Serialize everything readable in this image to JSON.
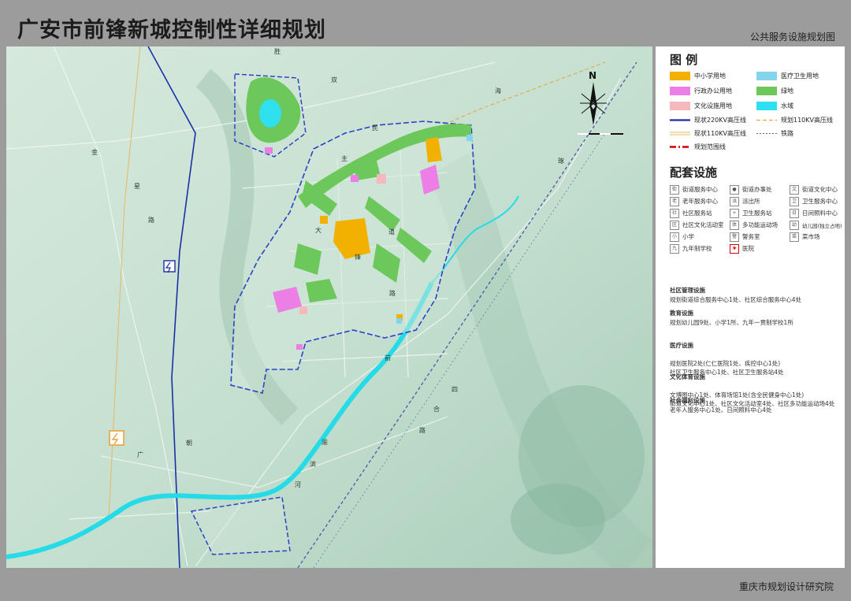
{
  "header": {
    "title": "广安市前锋新城控制性详细规划",
    "subtitle": "公共服务设施规划图"
  },
  "footer": {
    "org": "重庆市规划设计研究院"
  },
  "compass": {
    "label": "N"
  },
  "legend": {
    "title": "图 例",
    "items": [
      {
        "label": "中小学用地",
        "color": "#f2b000",
        "kind": "fill"
      },
      {
        "label": "医疗卫生用地",
        "color": "#84d4ee",
        "kind": "fill"
      },
      {
        "label": "行政办公用地",
        "color": "#ec7ee6",
        "kind": "fill"
      },
      {
        "label": "绿地",
        "color": "#6cc85a",
        "kind": "fill"
      },
      {
        "label": "文化设施用地",
        "color": "#f5b8bd",
        "kind": "fill"
      },
      {
        "label": "水域",
        "color": "#2fe0ee",
        "kind": "fill"
      },
      {
        "label": "现状220KV高压线",
        "color": "#1a2fa8",
        "kind": "line-solid-thick"
      },
      {
        "label": "规划110KV高压线",
        "color": "#e8a43a",
        "kind": "line-dash"
      },
      {
        "label": "现状110KV高压线",
        "color": "#e8b860",
        "kind": "line-double"
      },
      {
        "label": "铁路",
        "color": "#5a66b0",
        "kind": "line-dash-thin"
      },
      {
        "label": "规划范围线",
        "color": "#d00000",
        "kind": "line-dashdot"
      }
    ]
  },
  "facilities": {
    "title": "配套设施",
    "items": [
      {
        "icon": "街",
        "label": "街道服务中心"
      },
      {
        "icon": "●",
        "label": "街道办事处"
      },
      {
        "icon": "文",
        "label": "街道文化中心"
      },
      {
        "icon": "老",
        "label": "老年服务中心"
      },
      {
        "icon": "派",
        "label": "派出所"
      },
      {
        "icon": "卫",
        "label": "卫生服务中心"
      },
      {
        "icon": "社",
        "label": "社区服务站"
      },
      {
        "icon": "+",
        "label": "卫生服务站"
      },
      {
        "icon": "日",
        "label": "日间照料中心"
      },
      {
        "icon": "区",
        "label": "社区文化活动室"
      },
      {
        "icon": "体",
        "label": "多功能运动场"
      },
      {
        "icon": "幼",
        "label": "幼儿园(独立占地)"
      },
      {
        "icon": "小",
        "label": "小学"
      },
      {
        "icon": "警",
        "label": "警务室"
      },
      {
        "icon": "菜",
        "label": "菜市场"
      },
      {
        "icon": "九",
        "label": "九年制学校"
      },
      {
        "icon": "✚",
        "label": "医院"
      }
    ]
  },
  "summary": [
    {
      "head": "社区管理设施",
      "text": "规划街道综合服务中心1处、社区综合服务中心4处"
    },
    {
      "head": "教育设施",
      "text": "规划幼儿园9处、小学1所、九年一贯制学校1所"
    },
    {
      "head": "医疗设施",
      "text": "规划医院2处(仁仁医院1处、疾控中心1处)\n社区卫生服务中心1处、社区卫生服务站4处"
    },
    {
      "head": "文化体育设施",
      "text": "文博图中心1处、体育场馆1处(含全民健身中心1处)\n街道文化中心1处、社区文化活动室4处、社区多功能运动场4处"
    },
    {
      "head": "社会福利设施",
      "text": "老年人服务中心1处、日间照料中心4处"
    }
  ],
  "map_labels": [
    {
      "text": "金"
    },
    {
      "text": "星"
    },
    {
      "text": "路"
    },
    {
      "text": "胜"
    },
    {
      "text": "双"
    },
    {
      "text": "民"
    },
    {
      "text": "主"
    },
    {
      "text": "大"
    },
    {
      "text": "道"
    },
    {
      "text": "锋"
    },
    {
      "text": "路"
    },
    {
      "text": "前"
    },
    {
      "text": "四"
    },
    {
      "text": "合"
    },
    {
      "text": "路"
    },
    {
      "text": "朝"
    },
    {
      "text": "广"
    },
    {
      "text": "渝"
    },
    {
      "text": "滨"
    },
    {
      "text": "河"
    },
    {
      "text": "海"
    },
    {
      "text": "琢"
    }
  ]
}
